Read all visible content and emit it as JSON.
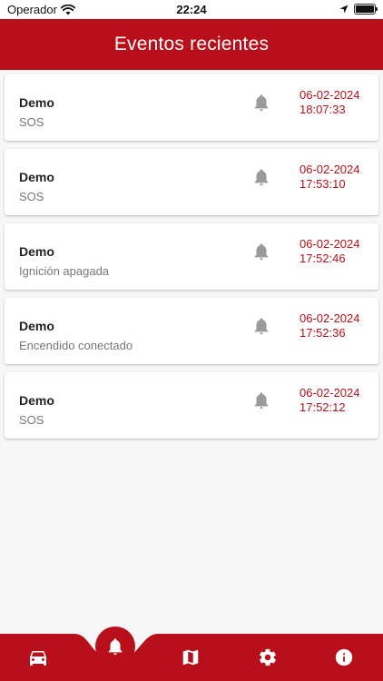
{
  "status_bar": {
    "carrier": "Operador",
    "time": "22:24"
  },
  "header": {
    "title": "Eventos recientes"
  },
  "events": [
    {
      "name": "Demo",
      "type": "SOS",
      "datetime": "06-02-2024 18:07:33",
      "icon": "bell-icon"
    },
    {
      "name": "Demo",
      "type": "SOS",
      "datetime": "06-02-2024 17:53:10",
      "icon": "bell-icon"
    },
    {
      "name": "Demo",
      "type": "Ignición apagada",
      "datetime": "06-02-2024 17:52:46",
      "icon": "bell-icon"
    },
    {
      "name": "Demo",
      "type": "Encendido conectado",
      "datetime": "06-02-2024 17:52:36",
      "icon": "bell-icon"
    },
    {
      "name": "Demo",
      "type": "SOS",
      "datetime": "06-02-2024 17:52:12",
      "icon": "bell-icon"
    }
  ],
  "bottom_nav": {
    "items": [
      {
        "icon": "car-icon",
        "active": false
      },
      {
        "icon": "bell-icon",
        "active": true
      },
      {
        "icon": "map-icon",
        "active": false
      },
      {
        "icon": "gear-icon",
        "active": false
      },
      {
        "icon": "info-icon",
        "active": false
      }
    ]
  },
  "colors": {
    "brand": "#b80f1a",
    "date_text": "#b80f1a",
    "bell_icon": "#9a9a9a"
  }
}
